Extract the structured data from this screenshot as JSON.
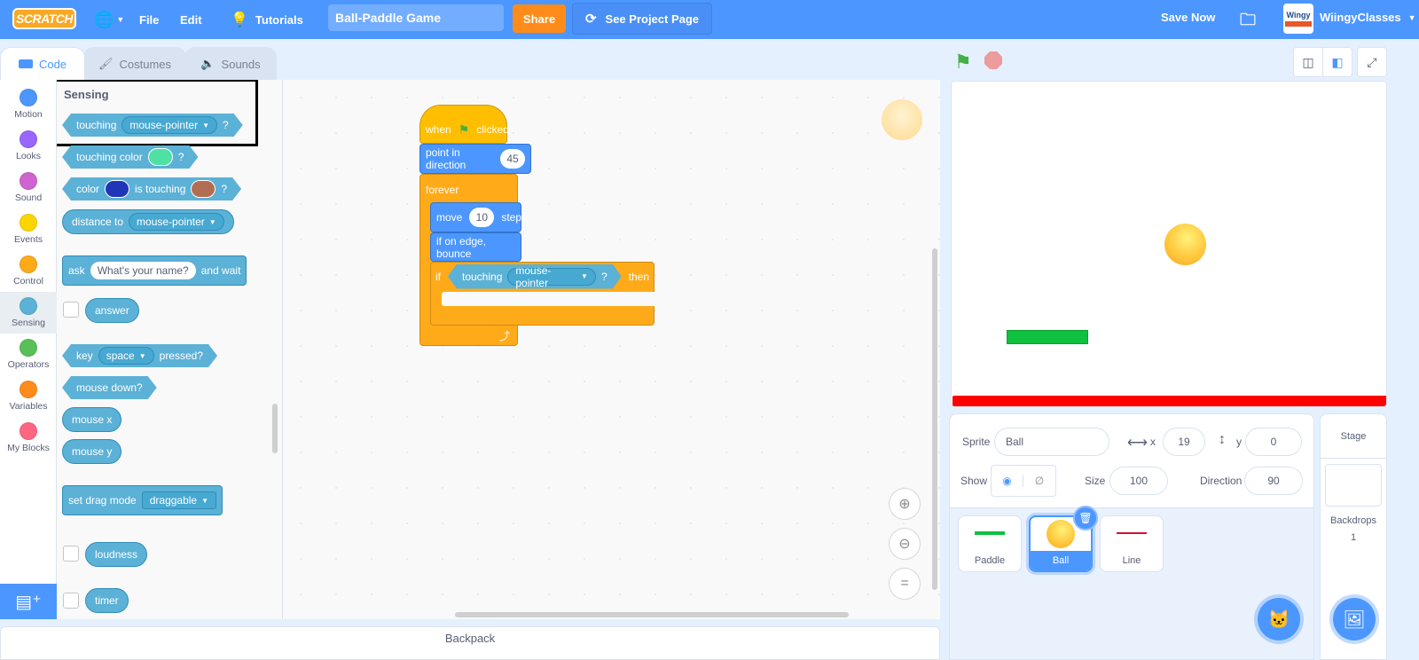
{
  "menubar": {
    "logo": "SCRATCH",
    "language_icon": "globe-icon",
    "file": "File",
    "edit": "Edit",
    "tutorials": "Tutorials",
    "project_title": "Ball-Paddle Game",
    "share": "Share",
    "see_project_page": "See Project Page",
    "save_now": "Save Now",
    "username": "WiingyClasses",
    "avatar_text": "Wingy"
  },
  "tabs": [
    {
      "label": "Code",
      "icon": "code-icon",
      "active": true
    },
    {
      "label": "Costumes",
      "icon": "brush-icon",
      "active": false
    },
    {
      "label": "Sounds",
      "icon": "speaker-icon",
      "active": false
    }
  ],
  "categories": [
    {
      "label": "Motion",
      "color": "#4c97ff"
    },
    {
      "label": "Looks",
      "color": "#9966ff"
    },
    {
      "label": "Sound",
      "color": "#cf63cf"
    },
    {
      "label": "Events",
      "color": "#ffd500"
    },
    {
      "label": "Control",
      "color": "#ffab19"
    },
    {
      "label": "Sensing",
      "color": "#5cb1d6",
      "active": true
    },
    {
      "label": "Operators",
      "color": "#59c059"
    },
    {
      "label": "Variables",
      "color": "#ff8c1a"
    },
    {
      "label": "My Blocks",
      "color": "#ff6680"
    }
  ],
  "palette": {
    "heading": "Sensing",
    "blocks": {
      "touching": {
        "label": "touching",
        "menu": "mouse-pointer",
        "suffix": "?"
      },
      "touching_color": {
        "label": "touching color",
        "swatch": "#4fe0a3",
        "suffix": "?"
      },
      "color_touching": {
        "label1": "color",
        "swatch1": "#1f36b8",
        "label2": "is touching",
        "swatch2": "#b26e53",
        "suffix": "?"
      },
      "distance_to": {
        "label": "distance to",
        "menu": "mouse-pointer"
      },
      "ask": {
        "label": "ask",
        "input": "What's your name?",
        "suffix": "and wait"
      },
      "answer": {
        "label": "answer"
      },
      "key_pressed": {
        "label": "key",
        "menu": "space",
        "suffix": "pressed?"
      },
      "mouse_down": {
        "label": "mouse down?"
      },
      "mouse_x": {
        "label": "mouse x"
      },
      "mouse_y": {
        "label": "mouse y"
      },
      "set_drag_mode": {
        "label": "set drag mode",
        "menu": "draggable"
      },
      "loudness": {
        "label": "loudness"
      },
      "timer": {
        "label": "timer"
      }
    }
  },
  "script": {
    "when_flag": {
      "label1": "when",
      "label2": "clicked"
    },
    "point_direction": {
      "label": "point in direction",
      "value": "45"
    },
    "forever": {
      "label": "forever"
    },
    "move": {
      "label1": "move",
      "value": "10",
      "label2": "steps"
    },
    "bounce": {
      "label": "if on edge, bounce"
    },
    "if_block": {
      "label": "if",
      "cond_label": "touching",
      "cond_menu": "mouse-pointer",
      "cond_suffix": "?",
      "then": "then"
    }
  },
  "backpack": "Backpack",
  "sprite_info": {
    "sprite_label": "Sprite",
    "sprite_name": "Ball",
    "x_label": "x",
    "x": "19",
    "y_label": "y",
    "y": "0",
    "show_label": "Show",
    "size_label": "Size",
    "size": "100",
    "direction_label": "Direction",
    "direction": "90"
  },
  "sprites": [
    {
      "name": "Paddle",
      "selected": false
    },
    {
      "name": "Ball",
      "selected": true
    },
    {
      "name": "Line",
      "selected": false
    }
  ],
  "stage_pane": {
    "title": "Stage",
    "backdrops_label": "Backdrops",
    "backdrops_count": "1"
  }
}
